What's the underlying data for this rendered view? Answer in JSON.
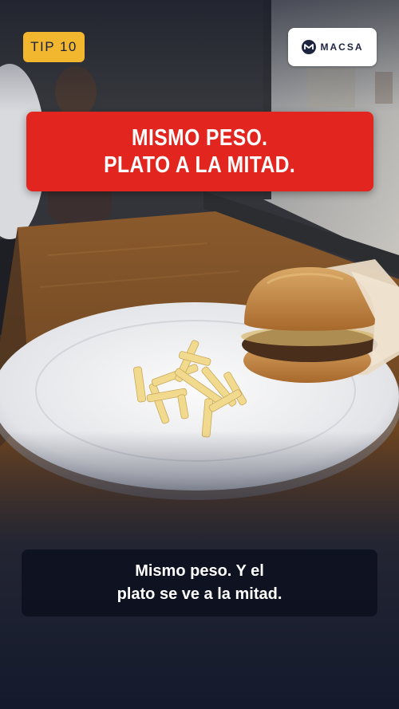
{
  "badge": {
    "label": "TIP 10"
  },
  "logo": {
    "text": "MACSA"
  },
  "headline": {
    "line1": "MISMO PESO.",
    "line2": "PLATO A LA MITAD."
  },
  "caption": {
    "line1": "Mismo peso. Y el",
    "line2": "plato se ve a la mitad."
  },
  "colors": {
    "badge": "#f2b62f",
    "headline_bg": "#e2261f",
    "caption_bg": "#0d1120",
    "brand_navy": "#1c2440"
  }
}
